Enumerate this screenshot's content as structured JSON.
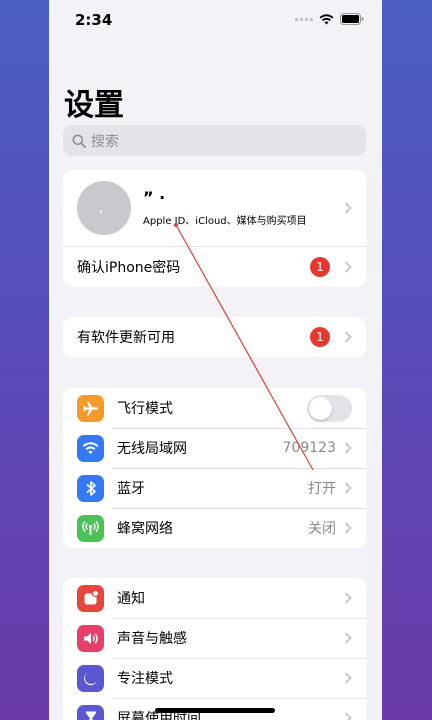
{
  "status_bar": {
    "time": "2:34"
  },
  "page": {
    "title": "设置"
  },
  "search": {
    "placeholder": "搜索"
  },
  "profile": {
    "avatar_text": ",",
    "name": "” ·",
    "subtitle": "Apple ID、iCloud、媒体与购买项目"
  },
  "account_rows": [
    {
      "label": "确认iPhone密码",
      "badge": "1"
    }
  ],
  "update_rows": [
    {
      "label": "有软件更新可用",
      "badge": "1"
    }
  ],
  "network_rows": [
    {
      "label": "飞行模式",
      "icon": "airplane-icon",
      "color": "#f39c2c",
      "toggle": false
    },
    {
      "label": "无线局域网",
      "icon": "wifi-icon",
      "color": "#3478f6",
      "value": "709123"
    },
    {
      "label": "蓝牙",
      "icon": "bluetooth-icon",
      "color": "#3478f6",
      "value": "打开"
    },
    {
      "label": "蜂窝网络",
      "icon": "cellular-icon",
      "color": "#4cc15a",
      "value": "关闭"
    }
  ],
  "notify_rows": [
    {
      "label": "通知",
      "icon": "notification-icon",
      "color": "#e5473e"
    },
    {
      "label": "声音与触感",
      "icon": "sound-icon",
      "color": "#e5406a"
    },
    {
      "label": "专注模式",
      "icon": "moon-icon",
      "color": "#5a57d0"
    },
    {
      "label": "屏幕使用时间",
      "icon": "hourglass-icon",
      "color": "#5a57d0"
    }
  ],
  "colors": {
    "badge": "#e5392f",
    "annotation_line": "#d9423a"
  }
}
